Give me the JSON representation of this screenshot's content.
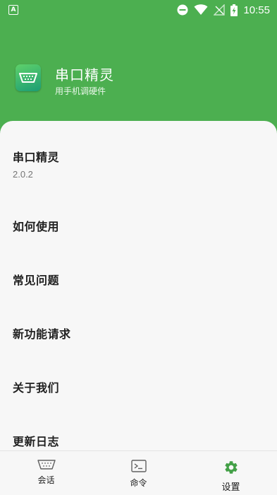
{
  "status_bar": {
    "left_icon": "A",
    "icons": [
      "do-not-disturb-icon",
      "wifi-icon",
      "no-signal-icon",
      "battery-charging-icon"
    ],
    "time": "10:55"
  },
  "header": {
    "app_name": "串口精灵",
    "app_tagline": "用手机调硬件",
    "icon": "serial-port-icon"
  },
  "settings": {
    "items": [
      {
        "title": "串口精灵",
        "subtitle": "2.0.2"
      },
      {
        "title": "如何使用"
      },
      {
        "title": "常见问题"
      },
      {
        "title": "新功能请求"
      },
      {
        "title": "关于我们"
      },
      {
        "title": "更新日志"
      }
    ]
  },
  "bottom_nav": {
    "items": [
      {
        "label": "会话",
        "icon": "serial-port-icon"
      },
      {
        "label": "命令",
        "icon": "terminal-icon"
      },
      {
        "label": "设置",
        "icon": "gear-icon",
        "active": true
      }
    ]
  },
  "colors": {
    "primary": "#4caf50",
    "card_bg": "#f7f7f7",
    "active_icon": "#43a047"
  }
}
